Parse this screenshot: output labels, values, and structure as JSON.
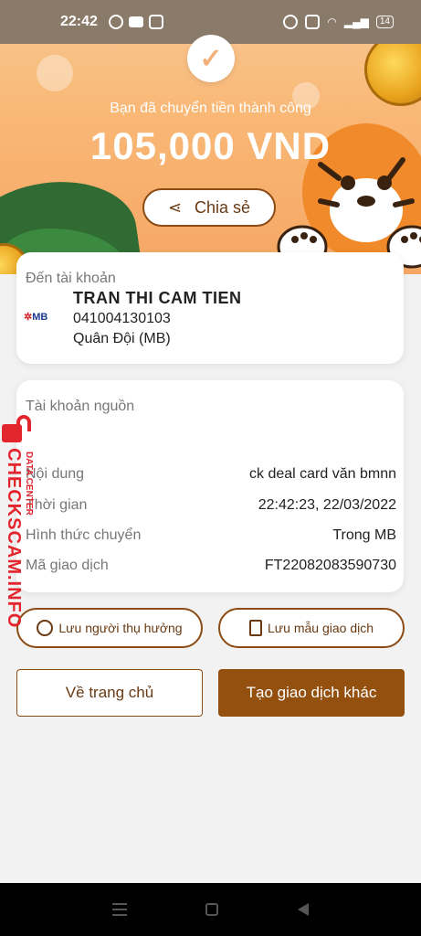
{
  "status_bar": {
    "time": "22:42",
    "battery": "14"
  },
  "hero": {
    "success_text": "Bạn đã chuyển tiền thành công",
    "amount": "105,000 VND",
    "share_label": "Chia sẻ"
  },
  "recipient": {
    "label": "Đến tài khoản",
    "bank_logo": "MB",
    "name": "TRAN THI CAM TIEN",
    "account_number": "041004130103",
    "bank_name": "Quân Đội (MB)"
  },
  "details": {
    "source_label": "Tài khoản nguồn",
    "rows": [
      {
        "key": "Nội dung",
        "value": "ck deal card văn bmnn"
      },
      {
        "key": "Thời gian",
        "value": "22:42:23, 22/03/2022"
      },
      {
        "key": "Hình thức chuyển",
        "value": "Trong MB"
      },
      {
        "key": "Mã giao dịch",
        "value": "FT22082083590730"
      }
    ]
  },
  "actions": {
    "save_beneficiary": "Lưu người thụ hưởng",
    "save_template": "Lưu mẫu giao dịch",
    "home": "Về trang chủ",
    "new_transaction": "Tạo giao dịch khác"
  },
  "watermark": {
    "main": "CHECKSCAM.INFO",
    "sub": "DATA CENTER"
  },
  "colors": {
    "brand_brown": "#93500f",
    "hero_orange": "#f9b876"
  }
}
